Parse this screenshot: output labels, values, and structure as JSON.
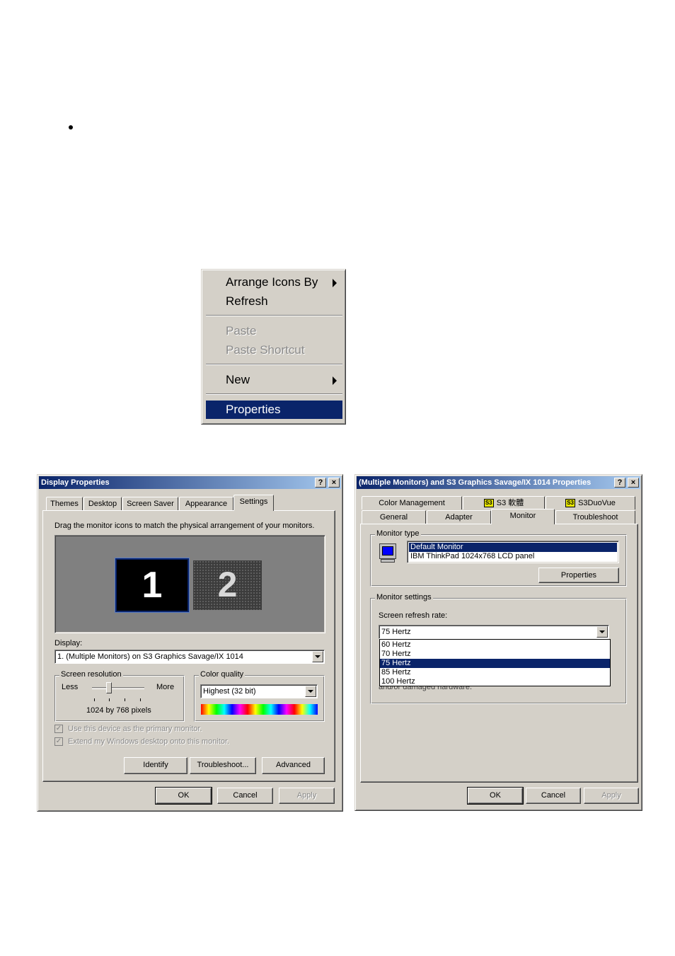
{
  "context_menu": {
    "items": [
      {
        "label": "Arrange Icons By"
      },
      {
        "label": "Refresh"
      },
      {
        "label": "Paste"
      },
      {
        "label": "Paste Shortcut"
      },
      {
        "label": "New"
      },
      {
        "label": "Properties"
      }
    ]
  },
  "display_properties": {
    "title": "Display Properties",
    "help_glyph": "?",
    "close_glyph": "×",
    "tabs": [
      "Themes",
      "Desktop",
      "Screen Saver",
      "Appearance",
      "Settings"
    ],
    "instruction": "Drag the monitor icons to match the physical arrangement of your monitors.",
    "monitor_1": "1",
    "monitor_2": "2",
    "display_label": "Display:",
    "display_value": "1. (Multiple Monitors) on S3 Graphics Savage/IX 1014",
    "resolution_group": "Screen resolution",
    "less": "Less",
    "more": "More",
    "resolution_value": "1024 by 768 pixels",
    "color_group": "Color quality",
    "color_value": "Highest (32 bit)",
    "primary_checkbox": "Use this device as the primary monitor.",
    "extend_checkbox": "Extend my Windows desktop onto this monitor.",
    "identify": "Identify",
    "troubleshoot": "Troubleshoot...",
    "advanced": "Advanced",
    "ok": "OK",
    "cancel": "Cancel",
    "apply": "Apply",
    "accent": "#0a246a"
  },
  "monitor_properties": {
    "title": "(Multiple Monitors) and S3 Graphics Savage/IX 1014 Properties",
    "help_glyph": "?",
    "close_glyph": "×",
    "tabs_row1": [
      "Color Management",
      "S3 軟體",
      "S3DuoVue"
    ],
    "s3_badge": "S3",
    "tabs_row2": [
      "General",
      "Adapter",
      "Monitor",
      "Troubleshoot"
    ],
    "monitor_type_group": "Monitor type",
    "monitor_list": [
      "Default Monitor",
      "IBM ThinkPad 1024x768 LCD panel"
    ],
    "properties": "Properties",
    "monitor_settings_group": "Monitor settings",
    "refresh_label": "Screen refresh rate:",
    "refresh_value": "75 Hertz",
    "refresh_options": [
      "60 Hertz",
      "70 Hertz",
      "75 Hertz",
      "85 Hertz",
      "100 Hertz"
    ],
    "hidden_text": "and/or damaged hardware.",
    "ok": "OK",
    "cancel": "Cancel",
    "apply": "Apply"
  }
}
